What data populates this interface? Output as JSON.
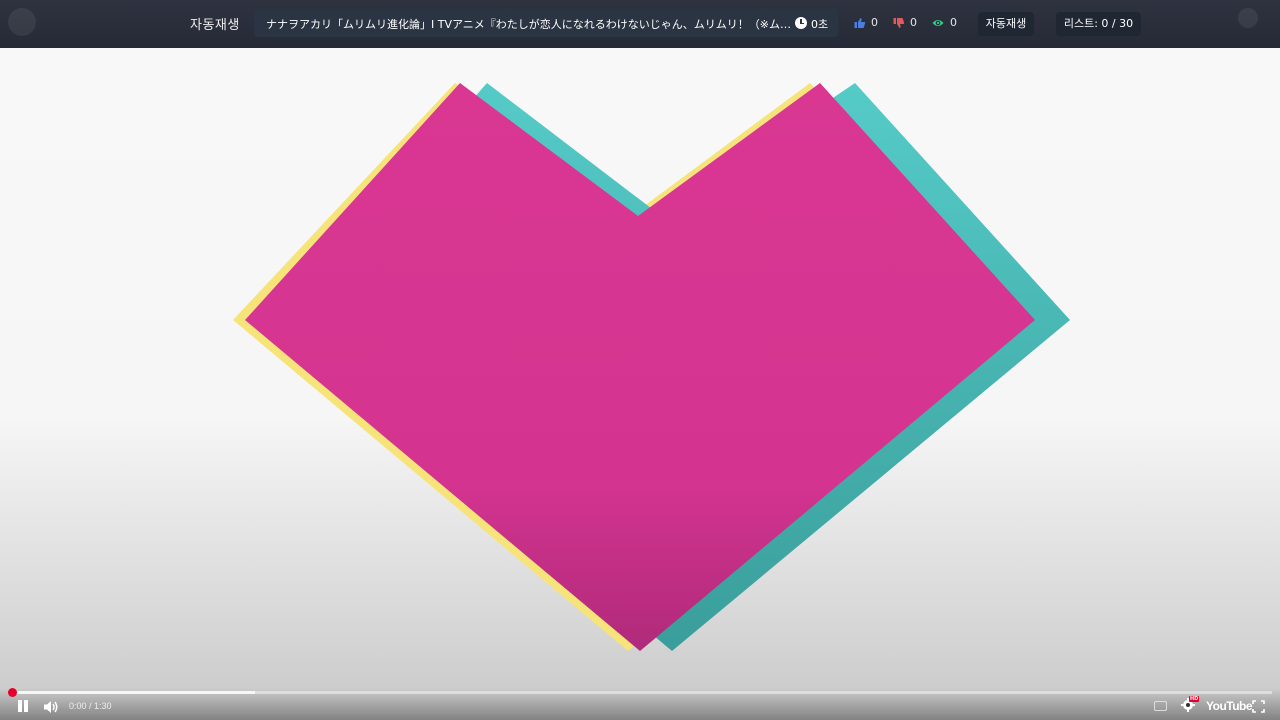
{
  "header": {
    "autoplay_title": "자동재생",
    "video_title": "ナナヲアカリ「ムリムリ進化論」I TVアニメ『わたしが恋人になれるわけないじゃん、ムリムリ！（※ムリじゃなかった!?）』オープニング",
    "elapsed_label": "0초",
    "likes": "0",
    "dislikes": "0",
    "views": "0",
    "autoplay_button": "자동재생",
    "list_label": "리스트: 0 / 30"
  },
  "player": {
    "time": "0:00 / 1:30",
    "progress_fraction": 0.0,
    "buffered_fraction": 0.193,
    "logo": "YouTube",
    "hd_badge": "HD"
  },
  "colors": {
    "topbar": "#2a2e3a",
    "heart_magenta": "#d63590",
    "heart_teal": "#4fc7c4",
    "heart_yellow": "#f6e47a",
    "like_blue": "#4a7fe0",
    "dislike_red": "#e05a5a",
    "view_green": "#2ed18a"
  },
  "icons": [
    "thumb-up-icon",
    "thumb-down-icon",
    "eye-icon",
    "clock-icon",
    "pause-icon",
    "volume-icon",
    "captions-icon",
    "settings-icon",
    "fullscreen-icon"
  ]
}
